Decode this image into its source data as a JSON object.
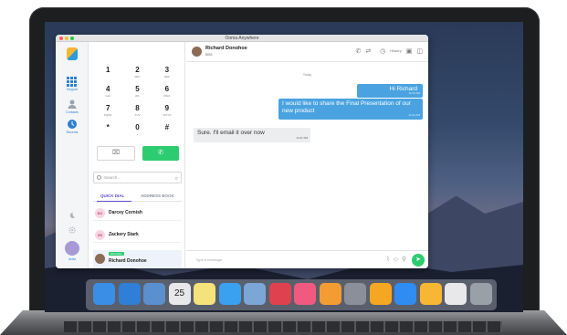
{
  "window_title": "Ooma Anywhere",
  "rail": {
    "nav": [
      {
        "label": "Keypad",
        "icon": "keypad-icon"
      },
      {
        "label": "Contacts",
        "icon": "contacts-icon"
      },
      {
        "label": "Recents",
        "icon": "recents-icon"
      }
    ],
    "bottom_icons": [
      "moon-icon",
      "gear-icon"
    ],
    "user_label": "Anita"
  },
  "keypad": [
    {
      "digit": "1",
      "letters": ""
    },
    {
      "digit": "2",
      "letters": "ABC"
    },
    {
      "digit": "3",
      "letters": "DEF"
    },
    {
      "digit": "4",
      "letters": "GHI"
    },
    {
      "digit": "5",
      "letters": "JKL"
    },
    {
      "digit": "6",
      "letters": "MNO"
    },
    {
      "digit": "7",
      "letters": "PQRS"
    },
    {
      "digit": "8",
      "letters": "TUV"
    },
    {
      "digit": "9",
      "letters": "WXYZ"
    },
    {
      "digit": "*",
      "letters": ""
    },
    {
      "digit": "0",
      "letters": "+"
    },
    {
      "digit": "#",
      "letters": ""
    }
  ],
  "search": {
    "placeholder": "Search..."
  },
  "tabs": {
    "quick_dial": "QUICK DIAL",
    "address_book": "ADDRESS BOOK"
  },
  "contacts": [
    {
      "initials": "DC",
      "name": "Darcey Cornish"
    },
    {
      "initials": "ZS",
      "name": "Zackery Stark"
    },
    {
      "initials": "RD",
      "name": "Richard Donohoe",
      "badge": "ON CALL"
    }
  ],
  "chat": {
    "contact_name": "Richard Donohoe",
    "contact_number": "8001",
    "history_label": "History",
    "day_label": "Today",
    "messages": [
      {
        "dir": "out",
        "text": "Hi Richard",
        "time": "11:04 AM"
      },
      {
        "dir": "out",
        "text": "I would like to share the Final Presentation of our new product",
        "time": "11:04 AM"
      },
      {
        "dir": "in",
        "text": "Sure. I'll email it over now",
        "time": "11:07 AM"
      }
    ],
    "compose_placeholder": "Type a message"
  },
  "dock": {
    "apps": [
      "finder-icon",
      "safari-icon",
      "photos-icon",
      "calendar-icon",
      "notes-icon",
      "messages-icon",
      "preview-icon",
      "news-icon",
      "music-icon",
      "books-icon",
      "system-preferences-icon",
      "home-icon",
      "app-store-icon",
      "ooma-icon",
      "downloads-icon",
      "trash-icon"
    ],
    "calendar_day": "25"
  },
  "colors": {
    "accent": "#2d7fd1",
    "call_green": "#2ecc71",
    "outgoing_bubble": "#4aa3e0",
    "tab_purple": "#5c4ec9"
  }
}
